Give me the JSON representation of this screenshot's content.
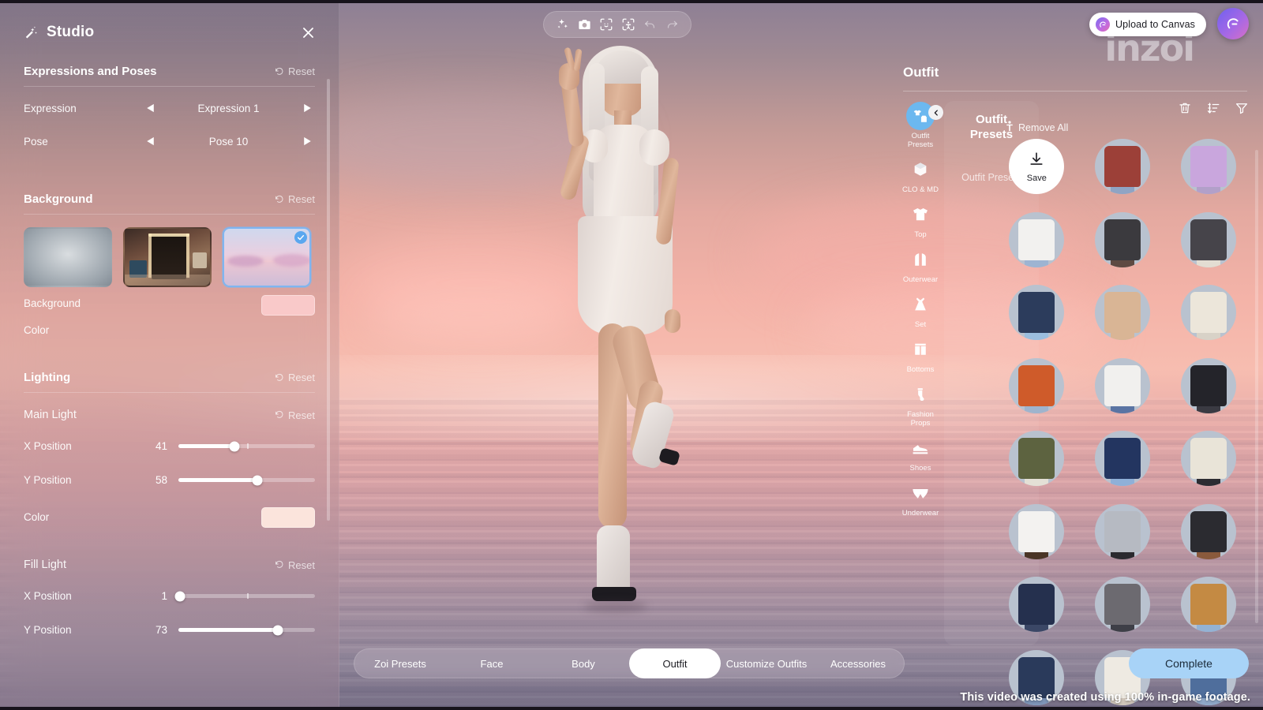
{
  "colors": {
    "accent_blue": "#6cb8ef",
    "complete_button": "#a8d3f7",
    "background_color_swatch": "#f9c9c9",
    "main_light_color_swatch": "#fbe4dc",
    "selected_outline": "#7fb5f0"
  },
  "top_toolbar": {
    "items": [
      {
        "name": "magic-enhance-icon",
        "label": "Magic Enhance"
      },
      {
        "name": "camera-icon",
        "label": "Camera"
      },
      {
        "name": "face-focus-icon",
        "label": "Face Focus"
      },
      {
        "name": "body-focus-icon",
        "label": "Body Focus"
      },
      {
        "name": "undo-icon",
        "label": "Undo"
      },
      {
        "name": "redo-icon",
        "label": "Redo"
      }
    ]
  },
  "header": {
    "upload_label": "Upload to Canvas",
    "watermark": "inzoi"
  },
  "studio": {
    "title": "Studio",
    "close_label": "Close",
    "sections": {
      "expressions": {
        "title": "Expressions and Poses",
        "reset_label": "Reset",
        "rows": [
          {
            "label": "Expression",
            "value": "Expression 1"
          },
          {
            "label": "Pose",
            "value": "Pose 10"
          }
        ]
      },
      "background": {
        "title": "Background",
        "reset_label": "Reset",
        "thumbs": [
          {
            "name": "studio-backdrop",
            "selected": false
          },
          {
            "name": "room-interior",
            "selected": false
          },
          {
            "name": "pink-sea-sunset",
            "selected": true
          }
        ],
        "color_label_line1": "Background",
        "color_label_line2": "Color",
        "color_value": "#f9c9c9"
      },
      "lighting": {
        "title": "Lighting",
        "reset_label": "Reset",
        "main_light": {
          "title": "Main Light",
          "reset_label": "Reset",
          "sliders": [
            {
              "label": "X Position",
              "value": 41,
              "percent": 41
            },
            {
              "label": "Y Position",
              "value": 58,
              "percent": 58
            }
          ],
          "color_label": "Color",
          "color_value": "#fbe4dc"
        },
        "fill_light": {
          "title": "Fill Light",
          "reset_label": "Reset",
          "sliders": [
            {
              "label": "X Position",
              "value": 1,
              "percent": 1
            },
            {
              "label": "Y Position",
              "value": 73,
              "percent": 73
            }
          ]
        }
      }
    }
  },
  "outfit": {
    "title": "Outfit",
    "subcategory_title": "Outfit\nPresets",
    "subcategory_item": "Outfit Presets",
    "remove_all_label": "Remove All",
    "tools": [
      {
        "name": "delete-icon",
        "label": "Delete"
      },
      {
        "name": "sort-icon",
        "label": "Sort"
      },
      {
        "name": "filter-icon",
        "label": "Filter"
      }
    ],
    "categories": [
      {
        "label": "Outfit Presets",
        "icon": "outfit-presets-icon",
        "active": true
      },
      {
        "label": "CLO & MD",
        "icon": "clo-md-cube-icon",
        "active": false
      },
      {
        "label": "Top",
        "icon": "tshirt-icon",
        "active": false
      },
      {
        "label": "Outerwear",
        "icon": "outerwear-icon",
        "active": false
      },
      {
        "label": "Set",
        "icon": "dress-set-icon",
        "active": false
      },
      {
        "label": "Bottoms",
        "icon": "shorts-icon",
        "active": false
      },
      {
        "label": "Fashion Props",
        "icon": "sock-icon",
        "active": false
      },
      {
        "label": "Shoes",
        "icon": "shoe-icon",
        "active": false
      },
      {
        "label": "Underwear",
        "icon": "underwear-icon",
        "active": false
      }
    ],
    "save_label": "Save",
    "thumbs": [
      {
        "name": "save-preset",
        "kind": "save"
      },
      {
        "name": "varsity-jacket-red",
        "garment": "#9c4038",
        "legs": "#8fa4c4"
      },
      {
        "name": "lilac-tiered-dress",
        "garment": "#c9a6dd",
        "legs": "#b2a0c9"
      },
      {
        "name": "white-graphic-tee",
        "garment": "#f2f1ef",
        "legs": "#9db4d2"
      },
      {
        "name": "black-white-hoodie",
        "garment": "#3b3a3e",
        "legs": "#5e4a42"
      },
      {
        "name": "black-jacket-crop",
        "garment": "#46444a",
        "legs": "#e3ddd2"
      },
      {
        "name": "navy-bomber-denim",
        "garment": "#2c3c5c",
        "legs": "#9bbedf"
      },
      {
        "name": "beige-knit-dress",
        "garment": "#d9b595",
        "legs": "#d9b595"
      },
      {
        "name": "cream-cardigan",
        "garment": "#ece6da",
        "legs": "#d8d2c7"
      },
      {
        "name": "orange-shirt",
        "garment": "#cf5b2a",
        "legs": "#9fb4cd"
      },
      {
        "name": "white-blazer-denim",
        "garment": "#f1f0ee",
        "legs": "#5a74a3"
      },
      {
        "name": "black-button-shirt",
        "garment": "#24242a",
        "legs": "#3a3a42"
      },
      {
        "name": "olive-military-jacket",
        "garment": "#5d6340",
        "legs": "#e4e0d6"
      },
      {
        "name": "navy-varsity-jacket",
        "garment": "#233560",
        "legs": "#8fb0d8"
      },
      {
        "name": "cream-graphic-sweater",
        "garment": "#e9e4d8",
        "legs": "#2c2c32"
      },
      {
        "name": "white-tee-brown-skirt",
        "garment": "#f3f2f0",
        "legs": "#4a3526"
      },
      {
        "name": "sequin-jacket-black",
        "garment": "#b6bac2",
        "legs": "#2a2a2f"
      },
      {
        "name": "black-tee-leather-pants",
        "garment": "#2b2b30",
        "legs": "#8a5a3c"
      },
      {
        "name": "navy-blazer-blue-shirt",
        "garment": "#25304e",
        "legs": "#3b4766"
      },
      {
        "name": "grey-windbreaker",
        "garment": "#6c6a70",
        "legs": "#3e3f47"
      },
      {
        "name": "tan-jacket-denim",
        "garment": "#c48a43",
        "legs": "#93b2d4"
      },
      {
        "name": "navy-shirt-partial",
        "garment": "#2a3a5b",
        "legs": "#7e95b8"
      },
      {
        "name": "white-blouse-partial",
        "garment": "#eeeae2",
        "legs": "#d0c6ba"
      },
      {
        "name": "blue-shirt-partial",
        "garment": "#4f6e9c",
        "legs": "#8fa8c8"
      }
    ]
  },
  "tabbar": {
    "tabs": [
      {
        "label": "Zoi Presets",
        "active": false
      },
      {
        "label": "Face",
        "active": false
      },
      {
        "label": "Body",
        "active": false
      },
      {
        "label": "Outfit",
        "active": true
      },
      {
        "label": "Customize Outfits",
        "active": false
      },
      {
        "label": "Accessories",
        "active": false
      }
    ]
  },
  "footer": {
    "complete_label": "Complete",
    "note": "This video was created using 100% in-game footage."
  }
}
